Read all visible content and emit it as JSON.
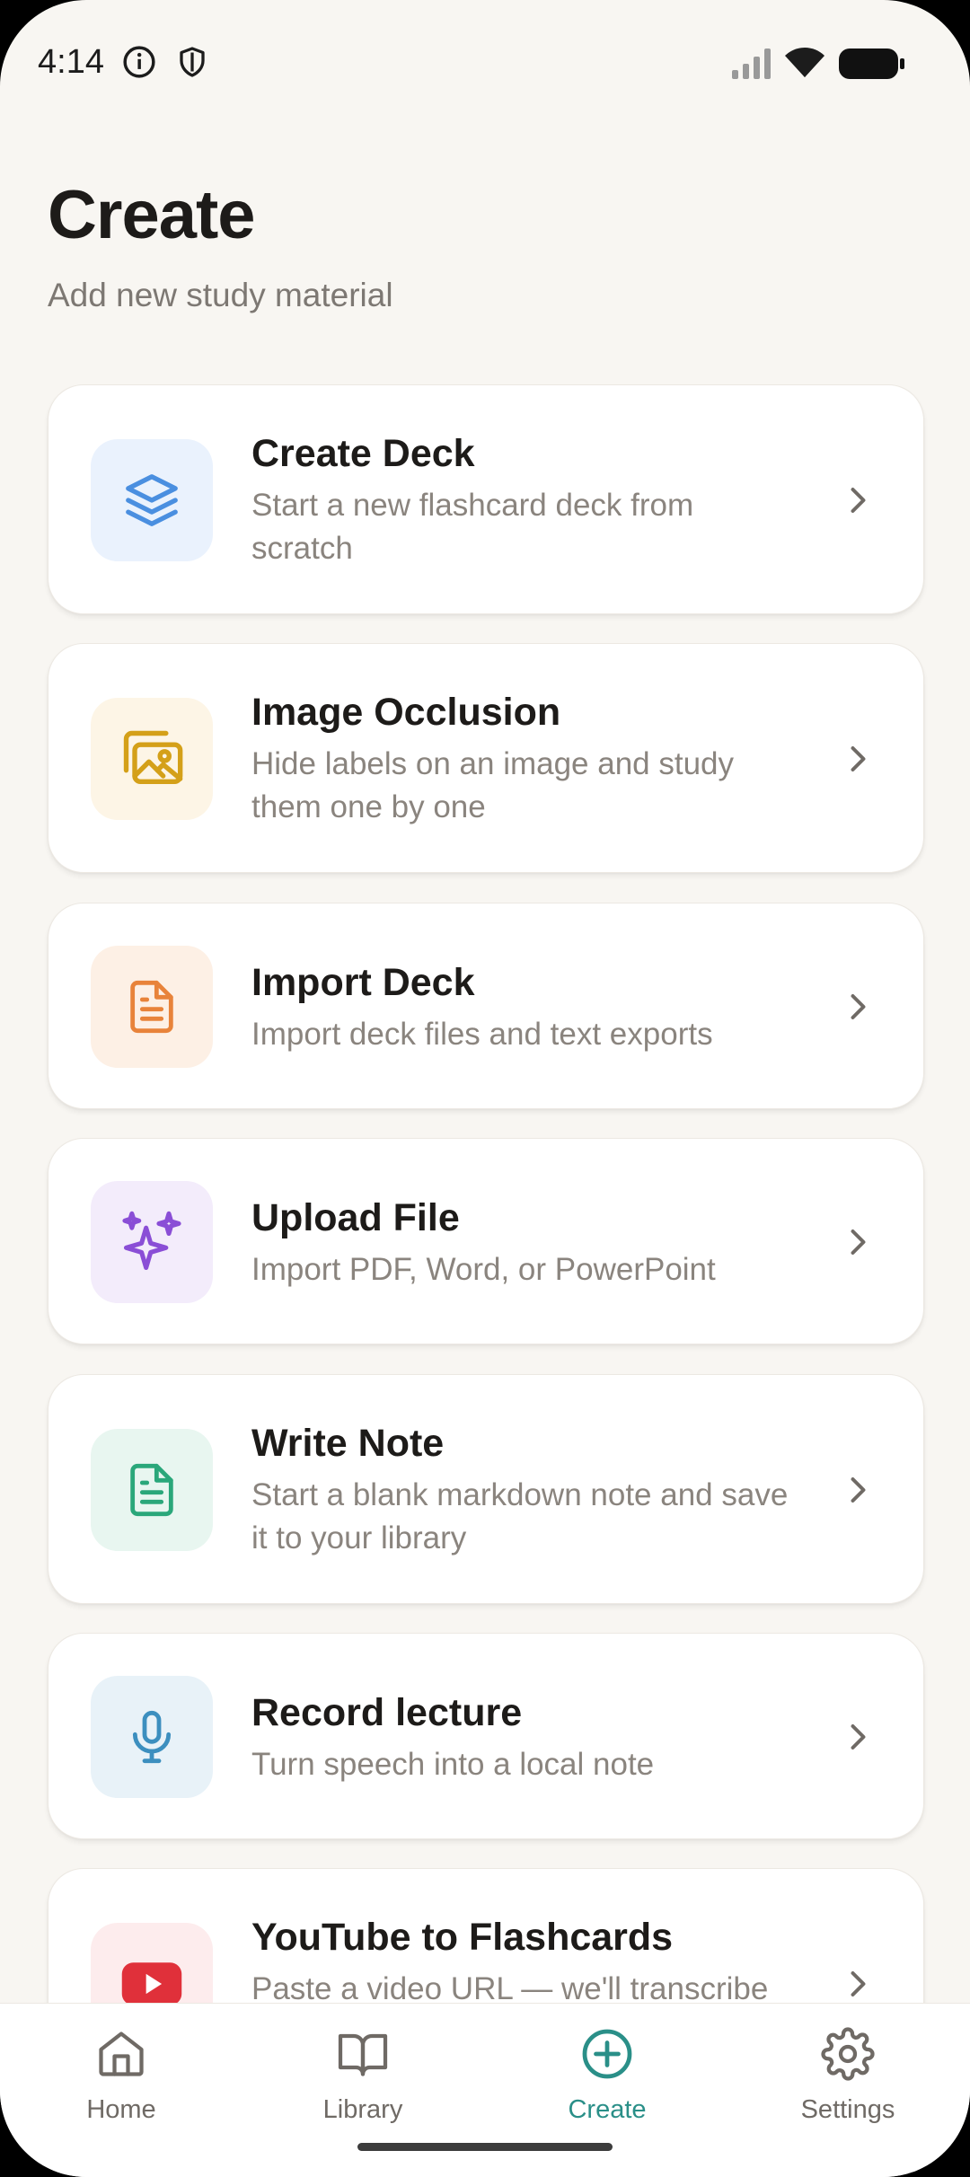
{
  "status_bar": {
    "time": "4:14",
    "icons": [
      "info-icon",
      "shield-icon",
      "signal-icon",
      "wifi-icon",
      "battery-icon"
    ]
  },
  "header": {
    "title": "Create",
    "subtitle": "Add new study material"
  },
  "cards": [
    {
      "title": "Create Deck",
      "description": "Start a new flashcard deck from scratch",
      "icon": "layers-icon",
      "icon_color": "#4a8fe0",
      "icon_bg": "#eaf2fd"
    },
    {
      "title": "Image Occlusion",
      "description": "Hide labels on an image and study them one by one",
      "icon": "images-icon",
      "icon_color": "#d4a019",
      "icon_bg": "#fdf5e6"
    },
    {
      "title": "Import Deck",
      "description": "Import deck files and text exports",
      "icon": "document-icon",
      "icon_color": "#e8833a",
      "icon_bg": "#fdf0e5"
    },
    {
      "title": "Upload File",
      "description": "Import PDF, Word, or PowerPoint",
      "icon": "sparkles-icon",
      "icon_color": "#8a4ed6",
      "icon_bg": "#f3ecfb"
    },
    {
      "title": "Write Note",
      "description": "Start a blank markdown note and save it to your library",
      "icon": "note-icon",
      "icon_color": "#2aa77a",
      "icon_bg": "#e8f6f0"
    },
    {
      "title": "Record lecture",
      "description": "Turn speech into a local note",
      "icon": "microphone-icon",
      "icon_color": "#3c8fbf",
      "icon_bg": "#e8f2f8"
    },
    {
      "title": "YouTube to Flashcards",
      "description": "Paste a video URL — we'll transcribe",
      "icon": "youtube-icon",
      "icon_color": "#e0303a",
      "icon_bg": "#fdeced"
    }
  ],
  "nav": {
    "items": [
      {
        "label": "Home",
        "icon": "home-icon"
      },
      {
        "label": "Library",
        "icon": "book-icon"
      },
      {
        "label": "Create",
        "icon": "plus-circle-icon",
        "active": true
      },
      {
        "label": "Settings",
        "icon": "gear-icon"
      }
    ],
    "active_color": "#2a8f88",
    "inactive_color": "#6f6a65"
  }
}
